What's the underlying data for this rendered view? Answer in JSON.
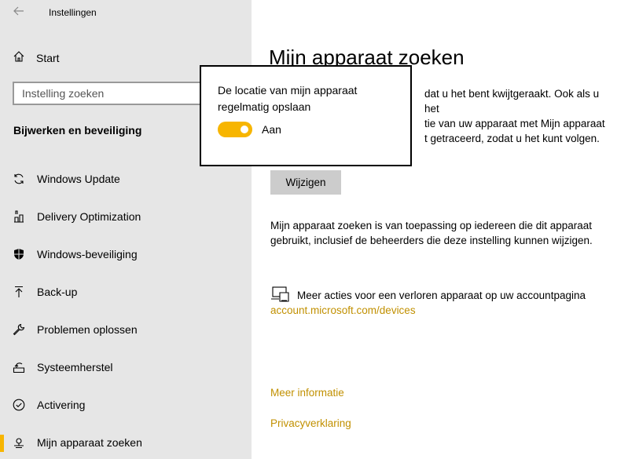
{
  "window": {
    "title": "Instellingen"
  },
  "sidebar": {
    "home_label": "Start",
    "search_placeholder": "Instelling zoeken",
    "section_title": "Bijwerken en beveiliging",
    "items": [
      {
        "label": "Windows Update",
        "icon": "sync-icon"
      },
      {
        "label": "Delivery Optimization",
        "icon": "delivery-optimization-icon"
      },
      {
        "label": "Windows-beveiliging",
        "icon": "shield-icon"
      },
      {
        "label": "Back-up",
        "icon": "backup-arrow-icon"
      },
      {
        "label": "Problemen oplossen",
        "icon": "wrench-icon"
      },
      {
        "label": "Systeemherstel",
        "icon": "recovery-icon"
      },
      {
        "label": "Activering",
        "icon": "check-circle-icon"
      },
      {
        "label": "Mijn apparaat zoeken",
        "icon": "find-device-icon",
        "selected": true
      }
    ]
  },
  "main": {
    "title": "Mijn apparaat zoeken",
    "description_lines": [
      "dat u het bent kwijtgeraakt. Ook als u het",
      "tie van uw apparaat met Mijn apparaat",
      "t getraceerd, zodat u het kunt volgen."
    ],
    "change_button": "Wijzigen",
    "applies_text": "Mijn apparaat zoeken is van toepassing op iedereen die dit apparaat gebruikt, inclusief de beheerders die deze instelling kunnen wijzigen.",
    "more_actions_text": "Meer acties voor een verloren apparaat op uw accountpagina",
    "account_link": "account.microsoft.com/devices",
    "more_info_link": "Meer informatie",
    "privacy_link": "Privacyverklaring"
  },
  "popup": {
    "title": "De locatie van mijn apparaat regelmatig opslaan",
    "toggle_label": "Aan",
    "toggle_on": true
  },
  "colors": {
    "accent": "#f7b500",
    "link": "#c19000",
    "sidebar_bg": "#e6e6e6"
  }
}
